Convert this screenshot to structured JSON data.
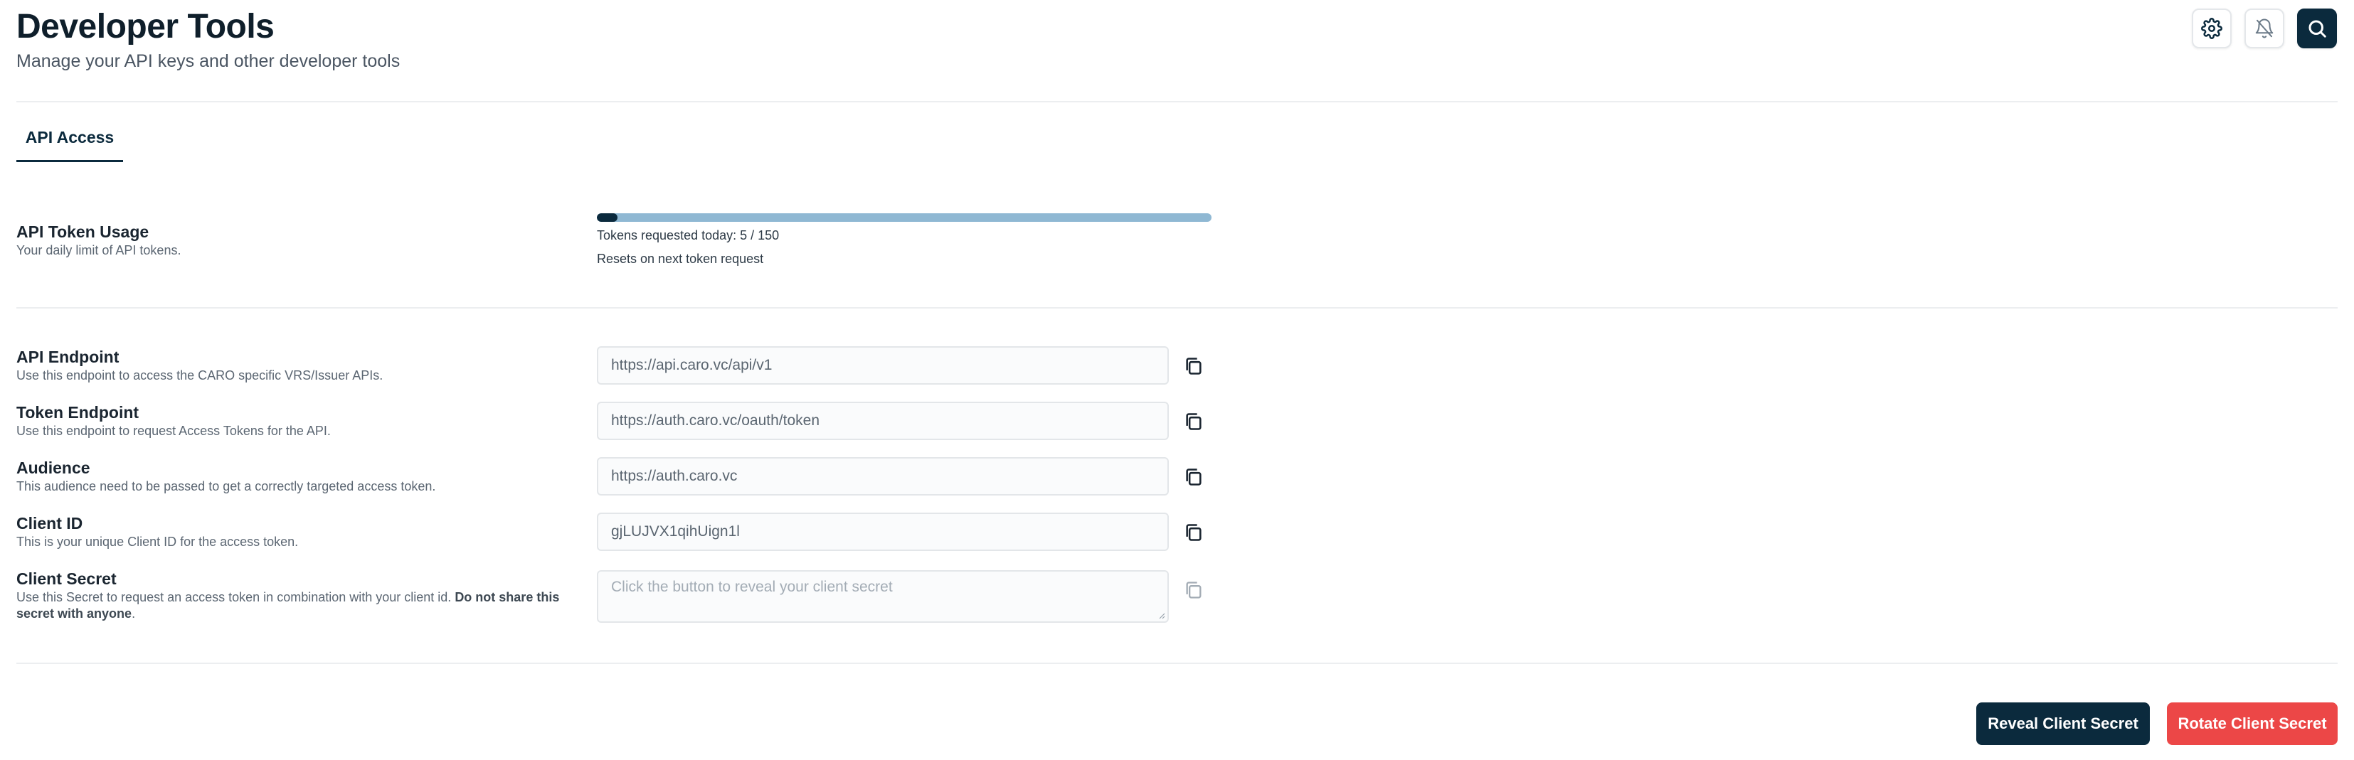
{
  "header": {
    "title": "Developer Tools",
    "subtitle": "Manage your API keys and other developer tools",
    "actions": [
      "gear-icon",
      "bell-icon",
      "search-icon"
    ]
  },
  "tabs": [
    {
      "label": "API Access",
      "active": true
    }
  ],
  "usage": {
    "label": "API Token Usage",
    "help": "Your daily limit of API tokens.",
    "used": 5,
    "limit": 150,
    "requested_text": "Tokens requested today: 5 / 150",
    "reset_text": "Resets on next token request"
  },
  "fields": [
    {
      "label": "API Endpoint",
      "help": "Use this endpoint to access the CARO specific VRS/Issuer APIs.",
      "value": "https://api.caro.vc/api/v1"
    },
    {
      "label": "Token Endpoint",
      "help": "Use this endpoint to request Access Tokens for the API.",
      "value": "https://auth.caro.vc/oauth/token"
    },
    {
      "label": "Audience",
      "help": "This audience need to be passed to get a correctly targeted access token.",
      "value": "https://auth.caro.vc"
    },
    {
      "label": "Client ID",
      "help": "This is your unique Client ID for the access token.",
      "value": "gjLUJVX1qihUign1l"
    }
  ],
  "client_secret": {
    "label": "Client Secret",
    "help_prefix": "Use this Secret to request an access token in combination with your client id. ",
    "help_bold": "Do not share this secret with anyone",
    "help_suffix": ".",
    "placeholder": "Click the button to reveal your client secret"
  },
  "buttons": {
    "reveal": "Reveal Client Secret",
    "rotate": "Rotate Client Secret"
  },
  "colors": {
    "primary": "#0b2a3d",
    "danger": "#ec4747",
    "progress_track": "#8fb8d3"
  }
}
